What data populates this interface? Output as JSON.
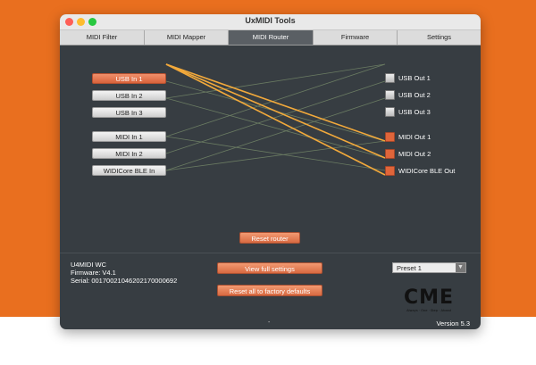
{
  "window": {
    "title": "UxMIDI Tools"
  },
  "tabs": [
    {
      "label": "MIDI Filter"
    },
    {
      "label": "MIDI Mapper"
    },
    {
      "label": "MIDI Router"
    },
    {
      "label": "Firmware"
    },
    {
      "label": "Settings"
    }
  ],
  "active_tab": "MIDI Router",
  "router": {
    "inputs": [
      {
        "label": "USB In 1",
        "selected": true
      },
      {
        "label": "USB In 2",
        "selected": false
      },
      {
        "label": "USB In 3",
        "selected": false
      },
      {
        "label": "MIDI In 1",
        "selected": false
      },
      {
        "label": "MIDI In 2",
        "selected": false
      },
      {
        "label": "WIDICore BLE In",
        "selected": false
      }
    ],
    "outputs": [
      {
        "label": "USB Out 1",
        "checked": false
      },
      {
        "label": "USB Out 2",
        "checked": false
      },
      {
        "label": "USB Out 3",
        "checked": false
      },
      {
        "label": "MIDI Out 1",
        "checked": true
      },
      {
        "label": "MIDI Out 2",
        "checked": true
      },
      {
        "label": "WIDICore BLE Out",
        "checked": true
      }
    ],
    "reset_label": "Reset router"
  },
  "device": {
    "name": "U4MIDI WC",
    "firmware": "Firmware: V4.1",
    "serial": "Serial: 00170021046202170000692"
  },
  "actions": {
    "view_settings": "View full settings",
    "factory_reset": "Reset all to factory defaults"
  },
  "preset": {
    "selected": "Preset 1"
  },
  "logo": {
    "text": "CME",
    "tagline": "Always · One · Step · Ahead"
  },
  "footer": {
    "separator": "-",
    "version": "Version 5.3"
  },
  "colors": {
    "accent": "#e0653a",
    "route_active": "#f2a93b",
    "background": "#e96f1f",
    "panel": "#373d42"
  }
}
